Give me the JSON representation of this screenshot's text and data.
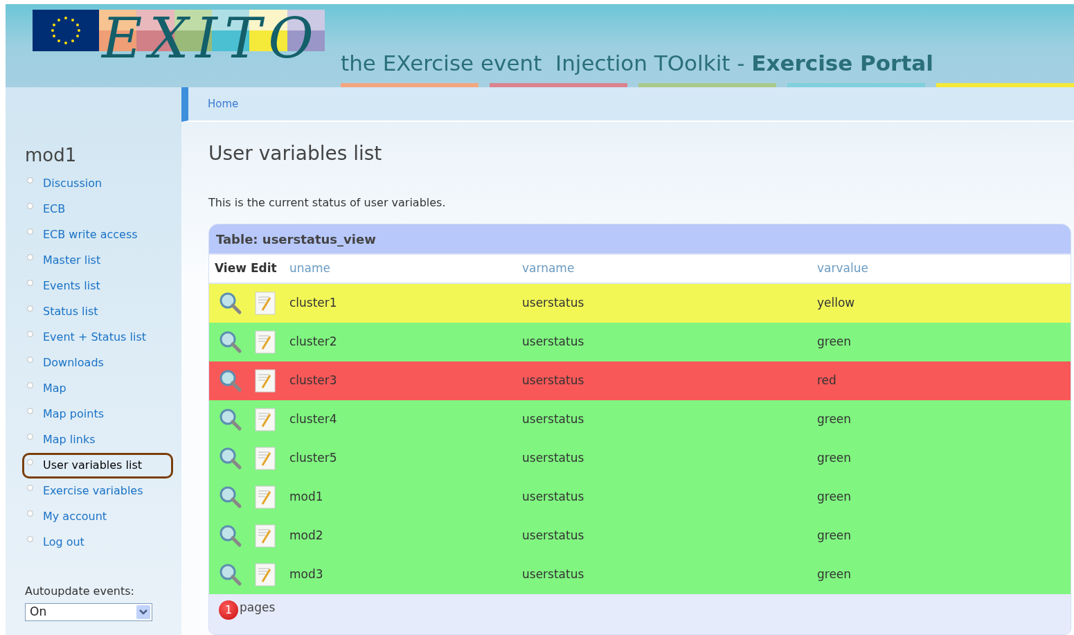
{
  "header": {
    "logo": "EXITO",
    "tagline": "the EXercise event  Injection TOolkit - **Exercise Portal**"
  },
  "breadcrumb": [
    "Home"
  ],
  "sidebar": {
    "title": "mod1",
    "items": [
      {
        "label": "Discussion",
        "selected": false
      },
      {
        "label": "ECB",
        "selected": false
      },
      {
        "label": "ECB write access",
        "selected": false
      },
      {
        "label": "Master list",
        "selected": false
      },
      {
        "label": "Events list",
        "selected": false
      },
      {
        "label": "Status list",
        "selected": false
      },
      {
        "label": "Event + Status list",
        "selected": false
      },
      {
        "label": "Downloads",
        "selected": false
      },
      {
        "label": "Map",
        "selected": false
      },
      {
        "label": "Map points",
        "selected": false
      },
      {
        "label": "Map links",
        "selected": false
      },
      {
        "label": "User variables list",
        "selected": true
      },
      {
        "label": "Exercise variables",
        "selected": false
      },
      {
        "label": "My account",
        "selected": false
      },
      {
        "label": "Log out",
        "selected": false
      }
    ],
    "autoupdate": {
      "label": "Autoupdate events:",
      "value": "On"
    }
  },
  "page": {
    "title": "User variables list",
    "description": "This is the current status of user variables."
  },
  "table": {
    "caption": "Table: userstatus_view",
    "columns": [
      "View",
      "Edit",
      "uname",
      "varname",
      "varvalue"
    ],
    "rows": [
      {
        "uname": "cluster1",
        "varname": "userstatus",
        "varvalue": "yellow",
        "color": "#f2f756"
      },
      {
        "uname": "cluster2",
        "varname": "userstatus",
        "varvalue": "green",
        "color": "#80f580"
      },
      {
        "uname": "cluster3",
        "varname": "userstatus",
        "varvalue": "red",
        "color": "#f85858"
      },
      {
        "uname": "cluster4",
        "varname": "userstatus",
        "varvalue": "green",
        "color": "#80f580"
      },
      {
        "uname": "cluster5",
        "varname": "userstatus",
        "varvalue": "green",
        "color": "#80f580"
      },
      {
        "uname": "mod1",
        "varname": "userstatus",
        "varvalue": "green",
        "color": "#80f580"
      },
      {
        "uname": "mod2",
        "varname": "userstatus",
        "varvalue": "green",
        "color": "#80f580"
      },
      {
        "uname": "mod3",
        "varname": "userstatus",
        "varvalue": "green",
        "color": "#80f580"
      }
    ],
    "pager": {
      "page": "1",
      "label": "pages"
    }
  }
}
